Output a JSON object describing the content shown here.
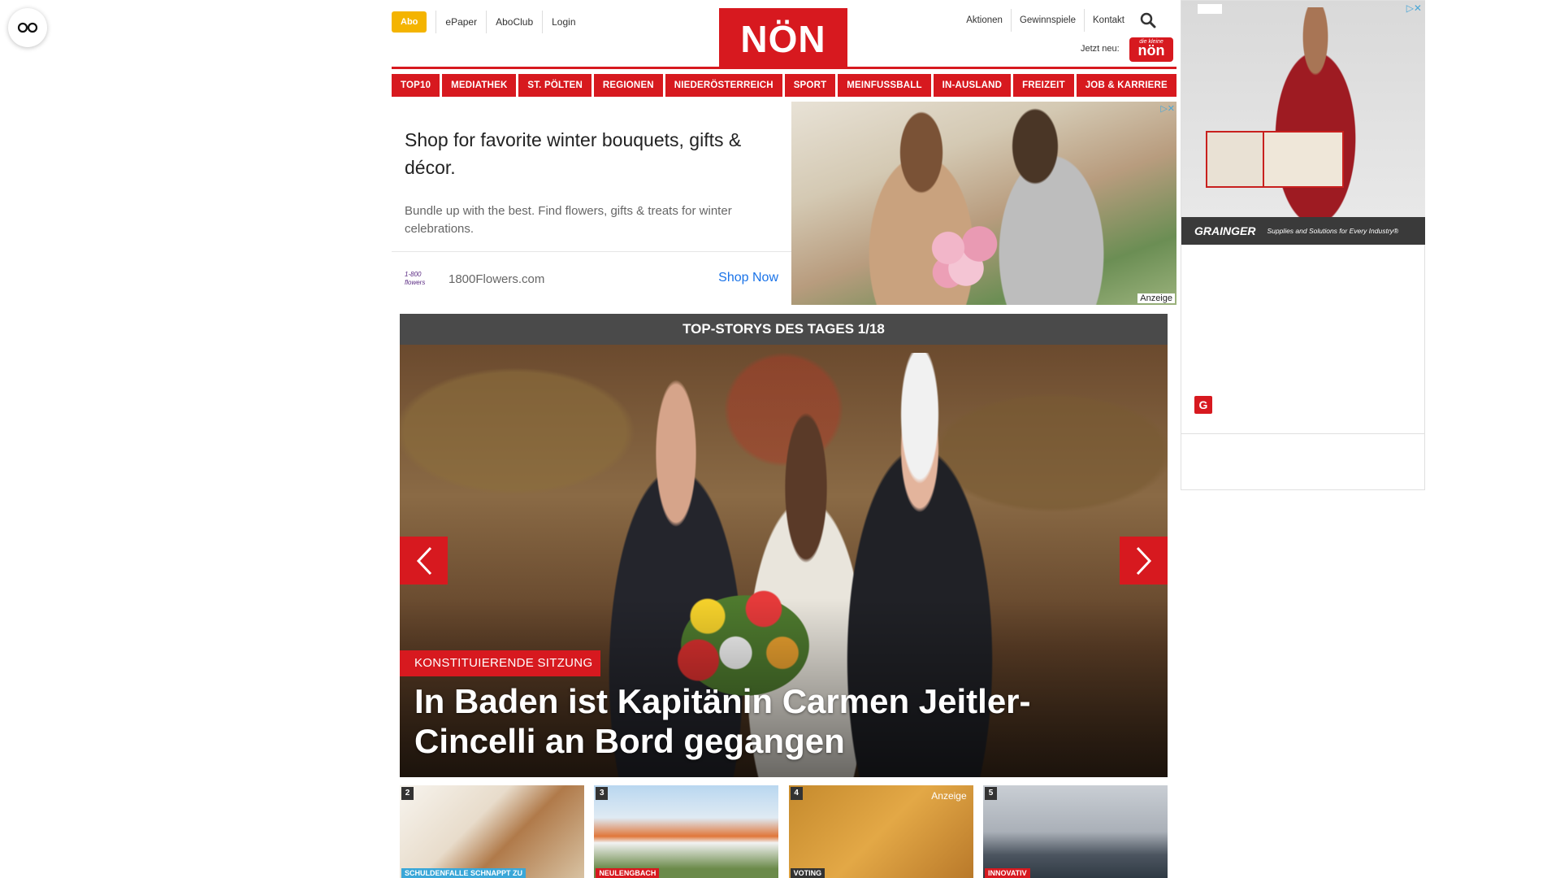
{
  "header": {
    "abo": "Abo",
    "links_left": [
      "ePaper",
      "AboClub",
      "Login"
    ],
    "logo": "NÖN",
    "links_right": [
      "Aktionen",
      "Gewinnspiele",
      "Kontakt"
    ],
    "jetzt_neu": "Jetzt neu:",
    "badge_script": "die kleine",
    "badge_text": "nön"
  },
  "nav": [
    "TOP10",
    "MEDIATHEK",
    "ST. PÖLTEN",
    "REGIONEN",
    "NIEDERÖSTERREICH",
    "SPORT",
    "MEINFUSSBALL",
    "IN-AUSLAND",
    "FREIZEIT",
    "JOB & KARRIERE"
  ],
  "ad": {
    "title": "Shop for favorite winter bouquets, gifts & décor.",
    "desc": "Bundle up with the best. Find flowers, gifts & treats for winter celebrations.",
    "brand_logo": "1-800 flowers",
    "brand": "1800Flowers.com",
    "cta": "Shop Now",
    "adchoice": "▷✕",
    "anzeige": "Anzeige"
  },
  "stories": {
    "heading": "TOP-STORYS DES TAGES 1/18",
    "hero_kicker": "KONSTITUIERENDE SITZUNG",
    "hero_title": "In Baden ist Kapitänin Carmen Jeitler-Cincelli an Bord gegangen",
    "thumbs": [
      {
        "num": "2",
        "kicker": "SCHULDENFALLE SCHNAPPT ZU",
        "kicker_color": "#3aa7d8",
        "anzeige": ""
      },
      {
        "num": "3",
        "kicker": "NEULENGBACH",
        "kicker_color": "#d7191f",
        "anzeige": ""
      },
      {
        "num": "4",
        "kicker": "VOTING",
        "kicker_color": "#333333",
        "anzeige": "Anzeige"
      },
      {
        "num": "5",
        "kicker": "INNOVATIV",
        "kicker_color": "#d7191f",
        "anzeige": ""
      }
    ]
  },
  "side_ad": {
    "brand": "GRAINGER",
    "tagline": "Supplies and Solutions for Every Industry®",
    "box_label": "GRAINGER",
    "adchoice": "▷✕",
    "logo": "G"
  },
  "colors": {
    "brand_red": "#d7191f",
    "abo_yellow": "#f4b400",
    "link_blue": "#1a73e8"
  }
}
